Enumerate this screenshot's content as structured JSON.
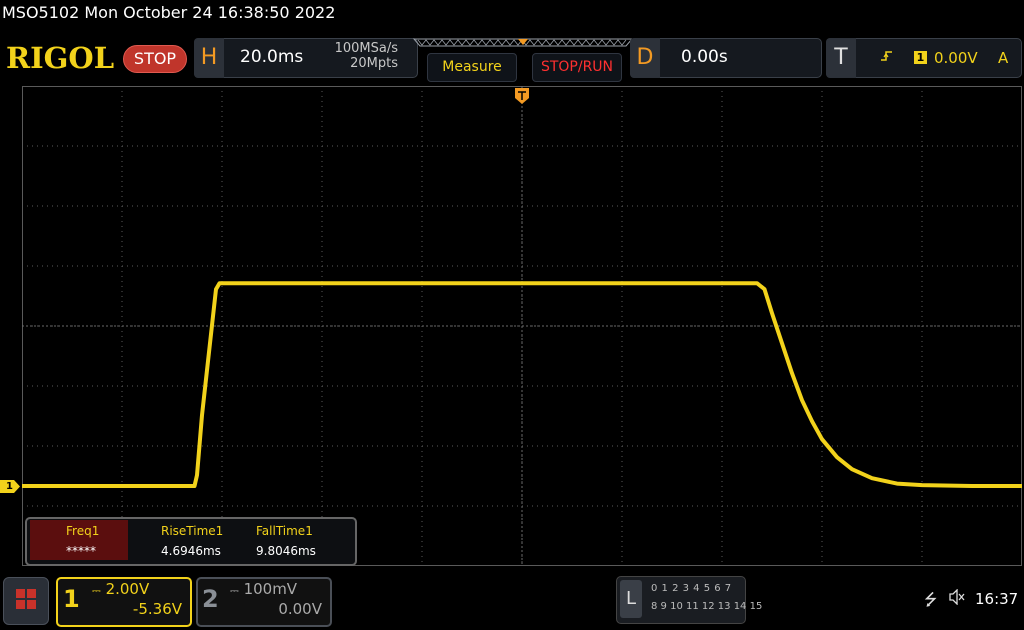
{
  "title": "MSO5102  Mon October 24 16:38:50 2022",
  "brand": "RIGOL",
  "run_state": "STOP",
  "horizontal": {
    "key": "H",
    "timebase": "20.0ms",
    "sample_rate": "100MSa/s",
    "memory_depth": "20Mpts"
  },
  "buttons": {
    "measure": "Measure",
    "stop_run": "STOP/RUN"
  },
  "delay": {
    "key": "D",
    "value": "0.00s"
  },
  "trigger": {
    "key": "T",
    "edge_icon": "rising-edge-icon",
    "source": "1",
    "level": "0.00V",
    "mode": "A"
  },
  "channel1": {
    "number": "1",
    "scale": "2.00V",
    "offset": "-5.36V",
    "marker": "1",
    "color": "#f2d21b"
  },
  "channel2": {
    "number": "2",
    "scale": "100mV",
    "offset": "0.00V"
  },
  "measurements": [
    {
      "label": "Freq1",
      "value": "*****"
    },
    {
      "label": "RiseTime1",
      "value": "4.6946ms"
    },
    {
      "label": "FallTime1",
      "value": "9.8046ms"
    }
  ],
  "logic": {
    "key": "L",
    "row1": "0 1 2 3   4 5 6 7",
    "row2": "8 9 10 11 12 13 14 15"
  },
  "status": {
    "usb_icon": "usb-icon",
    "sound_icon": "mute-icon",
    "clock": "16:37"
  },
  "chart_data": {
    "type": "line",
    "series": [
      {
        "x": [
          -100,
          -65.5,
          -65,
          -64,
          -62,
          -61.2,
          -60.5,
          -5,
          0,
          40,
          47,
          48.5,
          50,
          52,
          54,
          56,
          58,
          60,
          63,
          66,
          70,
          75,
          80,
          90,
          100
        ],
        "y": [
          -5.36,
          -5.36,
          -5.0,
          -3.0,
          0.0,
          1.2,
          1.4,
          1.4,
          1.4,
          1.4,
          1.4,
          1.2,
          0.4,
          -0.6,
          -1.6,
          -2.5,
          -3.2,
          -3.8,
          -4.4,
          -4.8,
          -5.1,
          -5.28,
          -5.33,
          -5.36,
          -5.36
        ]
      }
    ]
  },
  "colors": {
    "accent": "#f2d21b",
    "key": "#f39a23",
    "stop": "#c0352b",
    "stop_run": "#ff3030"
  }
}
